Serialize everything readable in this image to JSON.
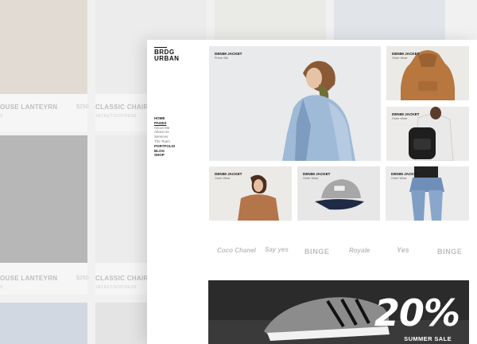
{
  "background": {
    "cards": [
      {
        "title": "OUSE LANTEYRN",
        "price": "$250",
        "category": "S"
      },
      {
        "title": "CLASSIC CHAIR",
        "price": "",
        "category": "JACKET/SOP/DESK"
      },
      {
        "title": "OUSE LANTEYRN",
        "price": "$250",
        "category": "S"
      },
      {
        "title": "CLASSIC CHAIR",
        "price": "",
        "category": "JACKET/SOP/DESK"
      }
    ]
  },
  "brand": {
    "line1": "BRDG",
    "line2": "URBAN"
  },
  "nav": {
    "home": "HOME",
    "pages": "PAGES",
    "sub": [
      "About Me",
      "About Us",
      "Services",
      "The Team"
    ],
    "portfolio": "PORTFOLIO",
    "blog": "BLOG",
    "shop": "SHOP"
  },
  "products": {
    "hero": {
      "title": "DENIM JACKET",
      "sub": "Prime Silk"
    },
    "top_right": {
      "title": "DENIM JACKET",
      "sub": "Outer Wear"
    },
    "mid_right": {
      "title": "DENIM JACKET",
      "sub": "Outer Wear"
    },
    "row": [
      {
        "title": "DENIM JACKET",
        "sub": "Outer Wear"
      },
      {
        "title": "DENIM JACKET",
        "sub": "Outer Wear"
      },
      {
        "title": "DENIM JACKET",
        "sub": "Outer Wear"
      }
    ]
  },
  "brands": [
    "Coco Chanel",
    "Say yes",
    "BINGE",
    "Royale",
    "Yes",
    "BINGE"
  ],
  "banner": {
    "percent": "20%",
    "label": "SUMMER SALE"
  },
  "colors": {
    "accent": "#111111",
    "banner": "#2a2a2a"
  }
}
